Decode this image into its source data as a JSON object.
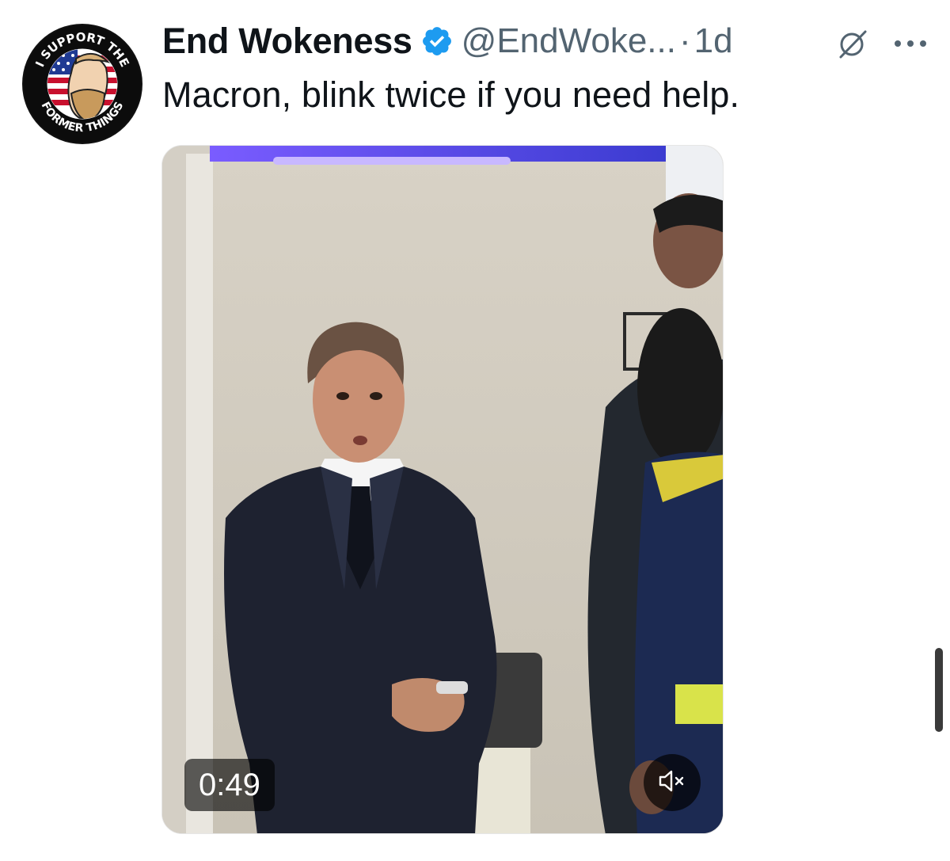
{
  "tweet": {
    "author_name": "End Wokeness",
    "verified": true,
    "handle": "@EndWoke...",
    "separator": "·",
    "time": "1d",
    "text": "Macron, blink twice if you need help.",
    "avatar": {
      "top_text": "I SUPPORT THE",
      "bottom_text": "FORMER THINGS"
    },
    "media": {
      "type": "video",
      "duration": "0:49",
      "muted": true
    }
  },
  "icons": {
    "verified": "verified-badge-icon",
    "grok": "grok-icon",
    "more": "more-options-icon",
    "mute": "muted-speaker-icon"
  },
  "colors": {
    "verified_blue": "#1d9bf0",
    "secondary_text": "#536471",
    "primary_text": "#0f1419"
  }
}
